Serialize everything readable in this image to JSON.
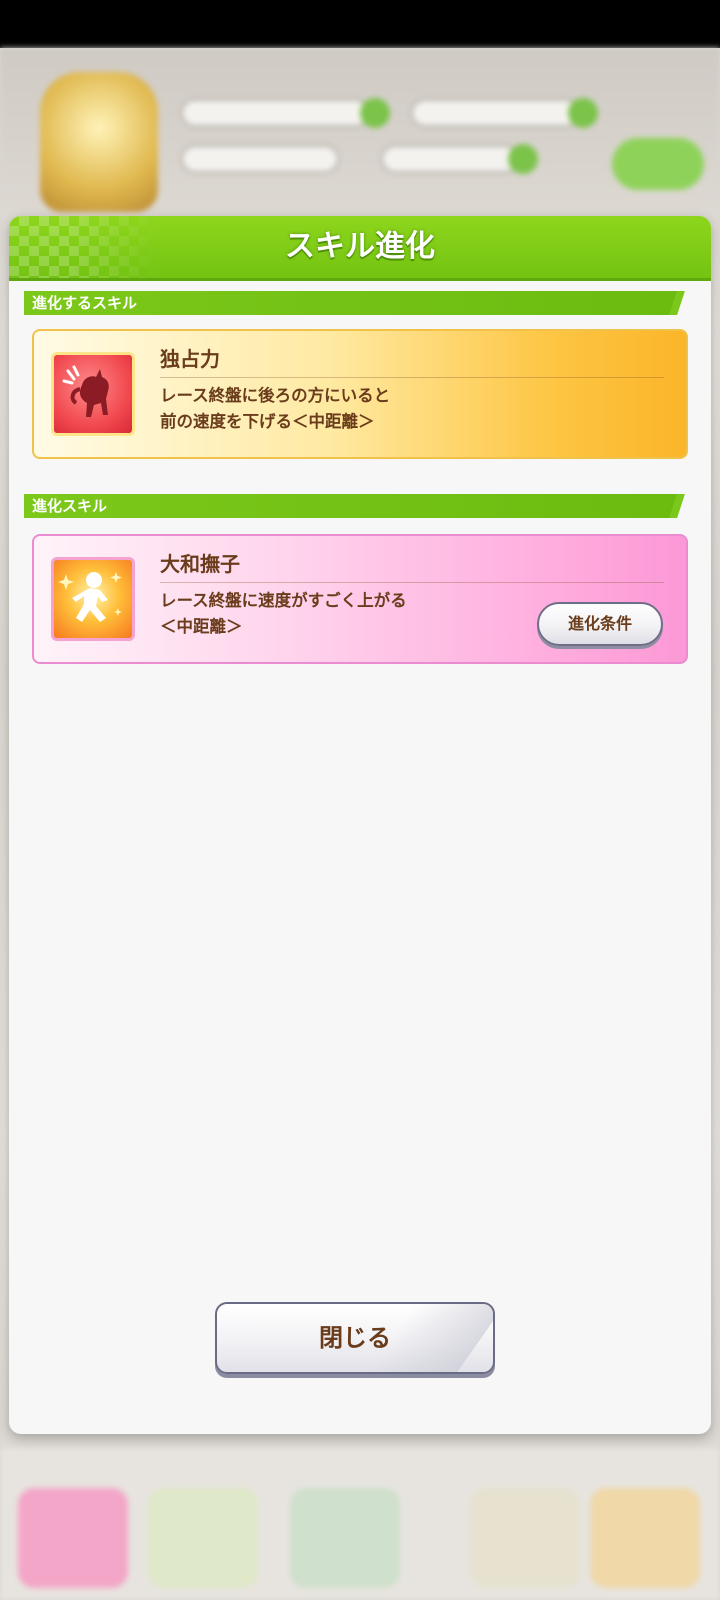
{
  "modal": {
    "title": "スキル進化",
    "close_label": "閉じる"
  },
  "sections": [
    {
      "label": "進化するスキル",
      "skill": {
        "name": "独占力",
        "icon": "horse-silhouette-sweat-icon",
        "description_lines": [
          "レース終盤に後ろの方にいると",
          "前の速度を下げる＜中距離＞"
        ]
      }
    },
    {
      "label": "進化スキル",
      "skill": {
        "name": "大和撫子",
        "icon": "running-horse-sparkle-icon",
        "description_lines": [
          "レース終盤に速度がすごく上がる",
          "＜中距離＞"
        ],
        "condition_button": "進化条件"
      }
    }
  ],
  "colors": {
    "header_green": "#7cc81a",
    "text_brown": "#6a3c1b",
    "gold_card": "#fbb52a",
    "pink_card": "#fb98d6"
  }
}
